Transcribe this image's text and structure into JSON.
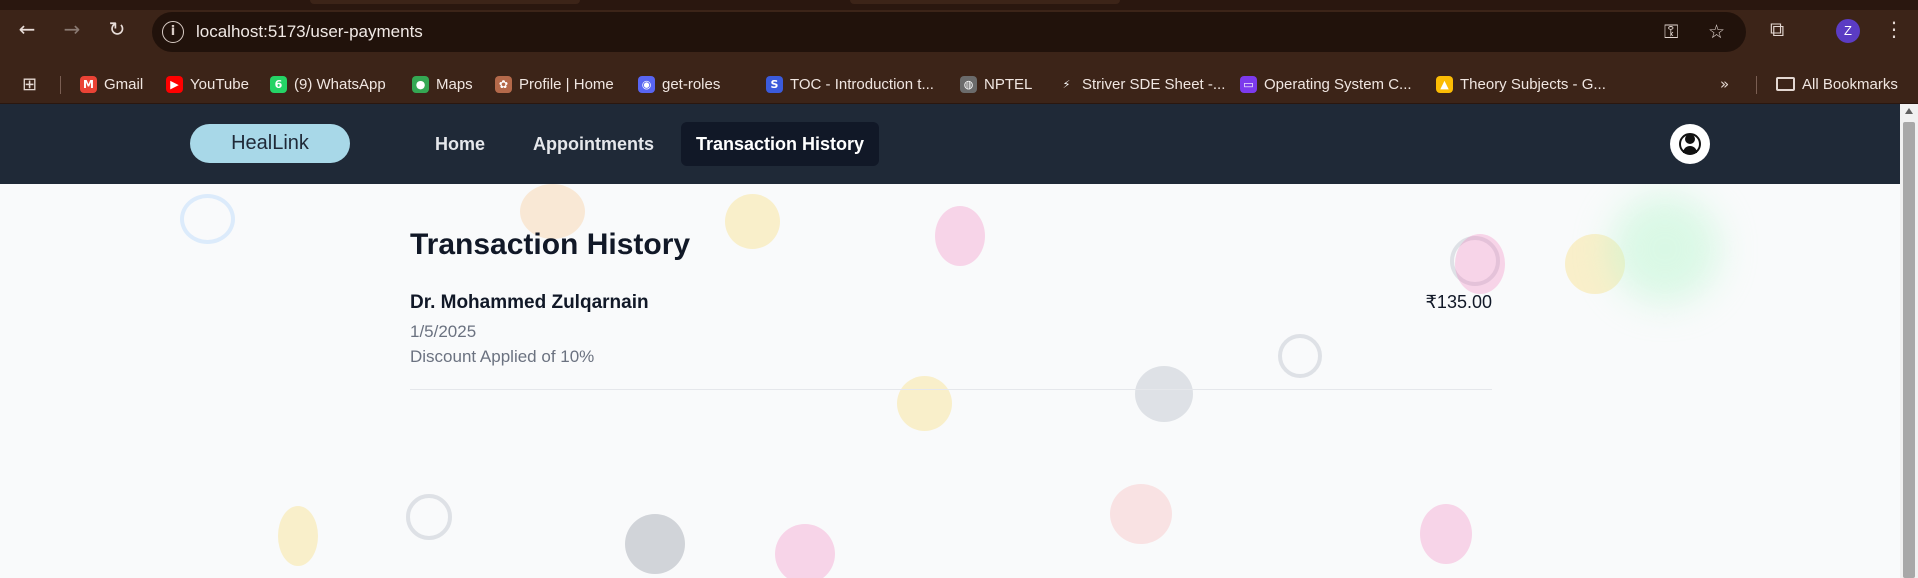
{
  "browser": {
    "url": "localhost:5173/user-payments",
    "bookmarks": [
      {
        "label": "Gmail",
        "icon": "gmail-icon",
        "color": "#ea4335",
        "glyph": "M"
      },
      {
        "label": "YouTube",
        "icon": "youtube-icon",
        "color": "#ff0000",
        "glyph": "▶"
      },
      {
        "label": "(9) WhatsApp",
        "icon": "whatsapp-icon",
        "color": "#25d366",
        "glyph": "6"
      },
      {
        "label": "Maps",
        "icon": "maps-icon",
        "color": "#34a853",
        "glyph": "●"
      },
      {
        "label": "Profile | Home",
        "icon": "profile-site-icon",
        "color": "#b4694a",
        "glyph": "✿"
      },
      {
        "label": "get-roles",
        "icon": "discord-icon",
        "color": "#5865f2",
        "glyph": "◉"
      },
      {
        "label": "TOC - Introduction t...",
        "icon": "toc-site-icon",
        "color": "#3b5bdb",
        "glyph": "S"
      },
      {
        "label": "NPTEL",
        "icon": "globe-icon",
        "color": "#6b6b6b",
        "glyph": "◍"
      },
      {
        "label": "Striver SDE Sheet -...",
        "icon": "striver-icon",
        "color": "#3c2418",
        "glyph": "⚡"
      },
      {
        "label": "Operating System C...",
        "icon": "os-site-icon",
        "color": "#7c3aed",
        "glyph": "▭"
      },
      {
        "label": "Theory Subjects - G...",
        "icon": "google-drive-icon",
        "color": "#fbbc04",
        "glyph": "▲"
      }
    ],
    "all_bookmarks_label": "All Bookmarks",
    "profile_initial": "Z"
  },
  "app": {
    "logo": "HealLink",
    "nav": [
      {
        "label": "Home",
        "active": false
      },
      {
        "label": "Appointments",
        "active": false
      },
      {
        "label": "Transaction History",
        "active": true
      }
    ]
  },
  "page": {
    "title": "Transaction History",
    "transactions": [
      {
        "doctor": "Dr. Mohammed Zulqarnain",
        "date": "1/5/2025",
        "note": "Discount Applied of 10%",
        "amount": "₹135.00"
      }
    ]
  }
}
